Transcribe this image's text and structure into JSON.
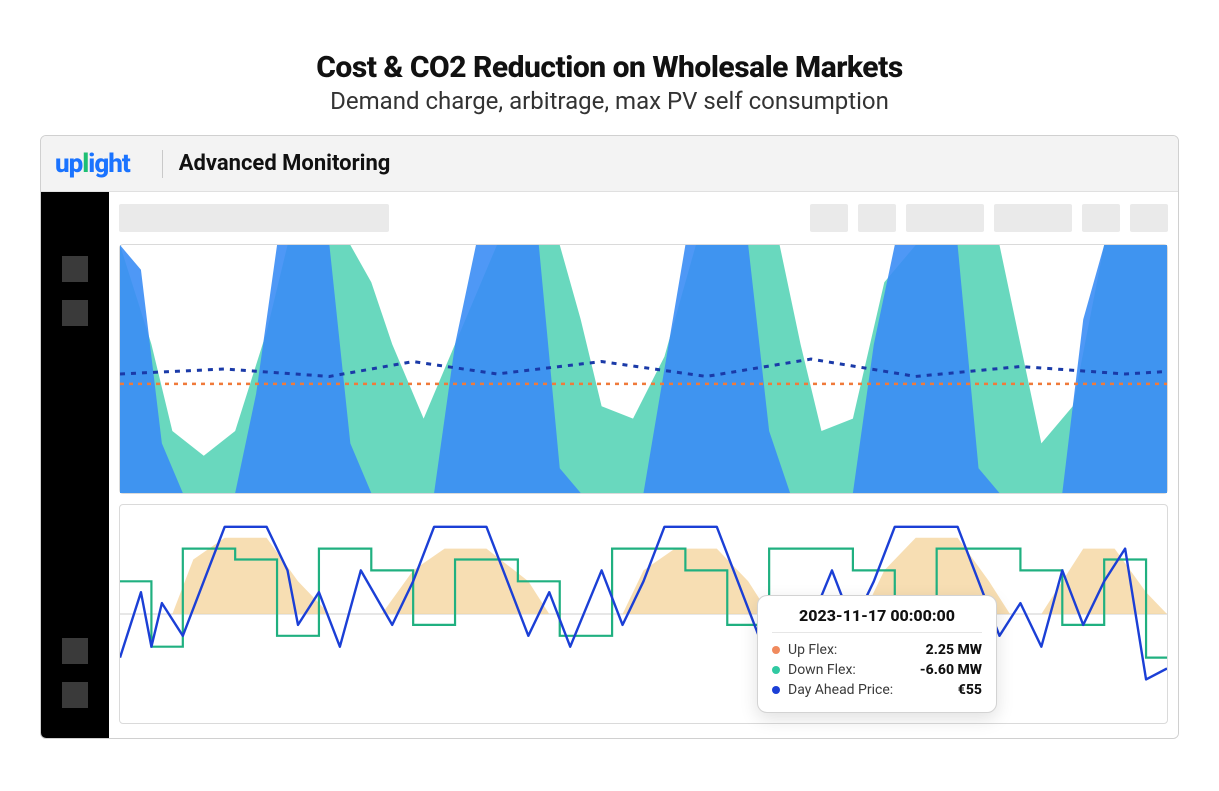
{
  "page": {
    "title": "Cost & CO2 Reduction on Wholesale Markets",
    "subtitle": "Demand charge, arbitrage, max PV self consumption"
  },
  "app": {
    "logo_text_a": "up",
    "logo_text_b": "l",
    "logo_text_c": "ight",
    "section_label": "Advanced Monitoring"
  },
  "tooltip": {
    "timestamp": "2023-11-17 00:00:00",
    "rows": {
      "up_flex": {
        "label": "Up Flex:",
        "value": "2.25 MW"
      },
      "down_flex": {
        "label": "Down Flex:",
        "value": "-6.60 MW"
      },
      "price": {
        "label": "Day Ahead Price:",
        "value": "€55"
      }
    }
  },
  "colors": {
    "teal": "#4fd1b3",
    "blue_fill": "#3b8df5",
    "dashed_navy": "#1a3aa8",
    "dashed_orange": "#f07a3a",
    "line_blue": "#1b3fd6",
    "line_green": "#20b080",
    "area_peach": "#f5d6a0"
  },
  "chart_data": [
    {
      "id": "top",
      "type": "area",
      "title": "",
      "xlabel": "",
      "ylabel": "",
      "x_range": [
        0,
        100
      ],
      "y_range": [
        0,
        100
      ],
      "series": [
        {
          "name": "teal_area",
          "pairs": [
            [
              0,
              100
            ],
            [
              3,
              60
            ],
            [
              5,
              25
            ],
            [
              8,
              15
            ],
            [
              11,
              25
            ],
            [
              14,
              65
            ],
            [
              16,
              100
            ],
            [
              22,
              100
            ],
            [
              24,
              85
            ],
            [
              26,
              60
            ],
            [
              29,
              30
            ],
            [
              33,
              70
            ],
            [
              36,
              100
            ],
            [
              42,
              100
            ],
            [
              44,
              70
            ],
            [
              46,
              35
            ],
            [
              49,
              30
            ],
            [
              52,
              55
            ],
            [
              55,
              100
            ],
            [
              63,
              100
            ],
            [
              65,
              60
            ],
            [
              67,
              25
            ],
            [
              70,
              30
            ],
            [
              73,
              85
            ],
            [
              76,
              100
            ],
            [
              84,
              100
            ],
            [
              86,
              60
            ],
            [
              88,
              20
            ],
            [
              91,
              35
            ],
            [
              94,
              100
            ],
            [
              100,
              100
            ]
          ]
        },
        {
          "name": "blue_area",
          "pairs": [
            [
              0,
              100
            ],
            [
              2,
              90
            ],
            [
              4,
              20
            ],
            [
              6,
              0
            ],
            [
              11,
              0
            ],
            [
              13,
              40
            ],
            [
              15,
              100
            ],
            [
              20,
              100
            ],
            [
              22,
              20
            ],
            [
              24,
              0
            ],
            [
              30,
              0
            ],
            [
              32,
              60
            ],
            [
              34,
              100
            ],
            [
              40,
              100
            ],
            [
              42,
              10
            ],
            [
              44,
              0
            ],
            [
              50,
              0
            ],
            [
              52,
              50
            ],
            [
              54,
              100
            ],
            [
              60,
              100
            ],
            [
              62,
              25
            ],
            [
              64,
              0
            ],
            [
              70,
              0
            ],
            [
              72,
              60
            ],
            [
              74,
              100
            ],
            [
              80,
              100
            ],
            [
              82,
              10
            ],
            [
              84,
              0
            ],
            [
              90,
              0
            ],
            [
              92,
              70
            ],
            [
              94,
              100
            ],
            [
              100,
              100
            ]
          ]
        },
        {
          "name": "navy_dashed_line",
          "pairs": [
            [
              0,
              48
            ],
            [
              10,
              50
            ],
            [
              20,
              47
            ],
            [
              28,
              53
            ],
            [
              36,
              48
            ],
            [
              46,
              53
            ],
            [
              56,
              47
            ],
            [
              66,
              54
            ],
            [
              76,
              47
            ],
            [
              86,
              51
            ],
            [
              96,
              48
            ],
            [
              100,
              49
            ]
          ]
        },
        {
          "name": "orange_dashed_line",
          "pairs": [
            [
              0,
              44
            ],
            [
              100,
              44
            ]
          ]
        }
      ]
    },
    {
      "id": "bottom",
      "type": "line",
      "title": "",
      "xlabel": "",
      "ylabel": "",
      "x_range": [
        0,
        100
      ],
      "y_range": [
        -10,
        10
      ],
      "series": [
        {
          "name": "peach_area",
          "pairs": [
            [
              5,
              0
            ],
            [
              7,
              5
            ],
            [
              10,
              7
            ],
            [
              14,
              7
            ],
            [
              17,
              3
            ],
            [
              20,
              0
            ],
            [
              25,
              0
            ],
            [
              28,
              4
            ],
            [
              31,
              6
            ],
            [
              35,
              6
            ],
            [
              39,
              3
            ],
            [
              41,
              0
            ],
            [
              48,
              0
            ],
            [
              50,
              4
            ],
            [
              53,
              6
            ],
            [
              57,
              6
            ],
            [
              60,
              3
            ],
            [
              62,
              0
            ],
            [
              71,
              0
            ],
            [
              73,
              4
            ],
            [
              76,
              7
            ],
            [
              80,
              7
            ],
            [
              83,
              3
            ],
            [
              85,
              0
            ],
            [
              88,
              0
            ],
            [
              90,
              3
            ],
            [
              92,
              6
            ],
            [
              95,
              6
            ],
            [
              98,
              2
            ],
            [
              100,
              0
            ]
          ]
        },
        {
          "name": "green_step",
          "pairs": [
            [
              0,
              3
            ],
            [
              3,
              3
            ],
            [
              3,
              -3
            ],
            [
              6,
              -3
            ],
            [
              6,
              6
            ],
            [
              11,
              6
            ],
            [
              11,
              5
            ],
            [
              15,
              5
            ],
            [
              15,
              -2
            ],
            [
              19,
              -2
            ],
            [
              19,
              6
            ],
            [
              24,
              6
            ],
            [
              24,
              4
            ],
            [
              28,
              4
            ],
            [
              28,
              -1
            ],
            [
              32,
              -1
            ],
            [
              32,
              5
            ],
            [
              38,
              5
            ],
            [
              38,
              3
            ],
            [
              42,
              3
            ],
            [
              42,
              -2
            ],
            [
              47,
              -2
            ],
            [
              47,
              6
            ],
            [
              54,
              6
            ],
            [
              54,
              4
            ],
            [
              58,
              4
            ],
            [
              58,
              -1
            ],
            [
              62,
              -1
            ],
            [
              62,
              6
            ],
            [
              70,
              6
            ],
            [
              70,
              4
            ],
            [
              74,
              4
            ],
            [
              74,
              -2
            ],
            [
              78,
              -2
            ],
            [
              78,
              6
            ],
            [
              86,
              6
            ],
            [
              86,
              4
            ],
            [
              90,
              4
            ],
            [
              90,
              -1
            ],
            [
              94,
              -1
            ],
            [
              94,
              5
            ],
            [
              98,
              5
            ],
            [
              98,
              -4
            ],
            [
              100,
              -4
            ]
          ]
        },
        {
          "name": "blue_price",
          "pairs": [
            [
              0,
              -4
            ],
            [
              2,
              2
            ],
            [
              3,
              -3
            ],
            [
              4,
              1
            ],
            [
              6,
              -2
            ],
            [
              8,
              3
            ],
            [
              10,
              8
            ],
            [
              14,
              8
            ],
            [
              16,
              4
            ],
            [
              17,
              -1
            ],
            [
              19,
              2
            ],
            [
              21,
              -3
            ],
            [
              23,
              4
            ],
            [
              26,
              -1
            ],
            [
              28,
              3
            ],
            [
              30,
              8
            ],
            [
              35,
              8
            ],
            [
              37,
              3
            ],
            [
              39,
              -2
            ],
            [
              41,
              2
            ],
            [
              43,
              -3
            ],
            [
              46,
              4
            ],
            [
              48,
              -1
            ],
            [
              50,
              3
            ],
            [
              52,
              8
            ],
            [
              57,
              8
            ],
            [
              59,
              3
            ],
            [
              61,
              -2
            ],
            [
              63,
              1
            ],
            [
              65,
              -3
            ],
            [
              68,
              4
            ],
            [
              70,
              -1
            ],
            [
              72,
              3
            ],
            [
              74,
              8
            ],
            [
              80,
              8
            ],
            [
              82,
              3
            ],
            [
              84,
              -2
            ],
            [
              86,
              1
            ],
            [
              88,
              -3
            ],
            [
              90,
              4
            ],
            [
              92,
              -1
            ],
            [
              94,
              3
            ],
            [
              96,
              6
            ],
            [
              98,
              -6
            ],
            [
              100,
              -5
            ]
          ]
        }
      ]
    }
  ]
}
